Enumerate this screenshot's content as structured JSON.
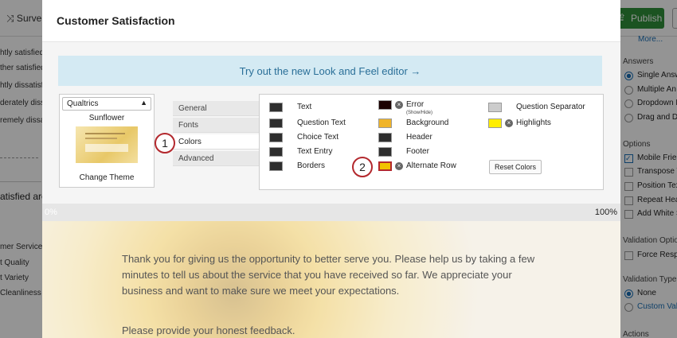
{
  "background": {
    "survey_tab": "⤨ Surve",
    "publish_label": "Publish",
    "more_link": "More...",
    "left_fragments": [
      "htly satisfied",
      "ther satisfied",
      "htly dissatisf",
      "derately dissa",
      "remely dissati"
    ],
    "left_question": "atisfied are",
    "left_rows": [
      "mer Service",
      "t Quality",
      "t Variety",
      "Cleanliness"
    ],
    "right_panel": {
      "answers_head": "Answers",
      "answers": [
        "Single Answ",
        "Multiple An",
        "Dropdown L",
        "Drag and Dr"
      ],
      "options_head": "Options",
      "options": [
        "Mobile Frier",
        "Transpose T",
        "Position Tex",
        "Repeat Hea",
        "Add White S"
      ],
      "validation_options_head": "Validation Optio",
      "validation_options": [
        "Force Respo"
      ],
      "validation_type_head": "Validation Type",
      "validation_types": [
        "None",
        "Custom Vali"
      ],
      "actions_head": "Actions"
    }
  },
  "modal": {
    "title": "Customer Satisfaction",
    "banner": "Try out the new Look and Feel editor →",
    "theme": {
      "select_value": "Qualtrics",
      "name": "Sunflower",
      "change_label": "Change Theme"
    },
    "nav": [
      {
        "label": "General",
        "active": false
      },
      {
        "label": "Fonts",
        "active": false
      },
      {
        "label": "Colors",
        "active": true
      },
      {
        "label": "Advanced",
        "active": false
      }
    ],
    "badges": [
      "1",
      "2"
    ],
    "colors": {
      "text": {
        "label": "Text",
        "color": "#2e2e2e"
      },
      "question_text": {
        "label": "Question Text",
        "color": "#2e2e2e"
      },
      "choice_text": {
        "label": "Choice Text",
        "color": "#2e2e2e"
      },
      "text_entry": {
        "label": "Text Entry",
        "color": "#2e2e2e"
      },
      "borders": {
        "label": "Borders",
        "color": "#2e2e2e"
      },
      "error": {
        "label": "Error",
        "sub": "(Show/Hide)",
        "color": "#1a0000"
      },
      "background": {
        "label": "Background",
        "color": "#f0b429"
      },
      "header": {
        "label": "Header",
        "color": "#2e2e2e"
      },
      "footer": {
        "label": "Footer",
        "color": "#2e2e2e"
      },
      "alternate_row": {
        "label": "Alternate Row",
        "color": "#f2c200",
        "border": "#b3282d"
      },
      "question_separator": {
        "label": "Question Separator",
        "color": "#cccccc"
      },
      "highlights": {
        "label": "Highlights",
        "color": "#ffee00"
      }
    },
    "reset_label": "Reset Colors",
    "progress": {
      "left": "0%",
      "right": "100%",
      "fraction": 0.0
    },
    "preview": {
      "intro": "Thank you for giving us the opportunity to better serve you. Please help us by taking a few minutes to tell us about the service that you have received so far. We appreciate your business and want to make sure we meet your expectations.",
      "question": "Please provide your honest feedback."
    }
  }
}
